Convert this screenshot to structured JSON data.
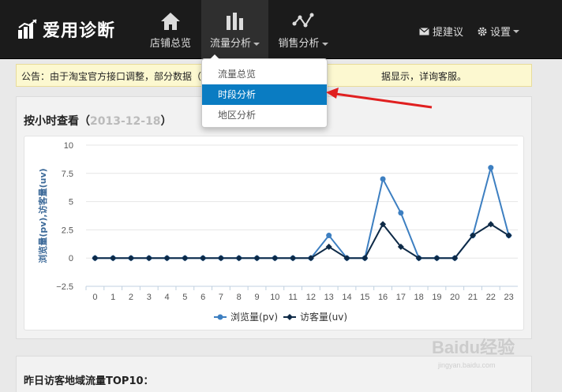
{
  "brand": {
    "name": "爱用诊断"
  },
  "nav": {
    "items": [
      {
        "label": "店铺总览",
        "icon": "home-icon"
      },
      {
        "label": "流量分析",
        "icon": "bar-chart-icon"
      },
      {
        "label": "销售分析",
        "icon": "line-chart-icon"
      }
    ],
    "suggest": "提建议",
    "settings": "设置"
  },
  "notice": {
    "prefix": "公告：由于淘宝官方接口调整，部分数据（",
    "suffix": "据显示，详询客服。"
  },
  "dropdown": {
    "items": [
      "流量总览",
      "时段分析",
      "地区分析"
    ],
    "active_index": 1
  },
  "panel": {
    "title": "按小时查看（",
    "date": "2013-12-18",
    "title_end": "）"
  },
  "chart_data": {
    "type": "line",
    "x": [
      0,
      1,
      2,
      3,
      4,
      5,
      6,
      7,
      8,
      9,
      10,
      11,
      12,
      13,
      14,
      15,
      16,
      17,
      18,
      19,
      20,
      21,
      22,
      23
    ],
    "ylim": [
      -2.5,
      10
    ],
    "yticks": [
      "10",
      "7.5",
      "5",
      "2.5",
      "0",
      "−2.5"
    ],
    "ylabel": "浏览量(pv),访客量(uv)",
    "legend_position": "bottom",
    "grid": true,
    "series": [
      {
        "name": "浏览量(pv)",
        "color": "#3d7fc1",
        "values": [
          0,
          0,
          0,
          0,
          0,
          0,
          0,
          0,
          0,
          0,
          0,
          0,
          0,
          2,
          0,
          0,
          7,
          4,
          0,
          0,
          0,
          2,
          8,
          2
        ]
      },
      {
        "name": "访客量(uv)",
        "color": "#0e2a47",
        "values": [
          0,
          0,
          0,
          0,
          0,
          0,
          0,
          0,
          0,
          0,
          0,
          0,
          0,
          1,
          0,
          0,
          3,
          1,
          0,
          0,
          0,
          2,
          3,
          2
        ]
      }
    ]
  },
  "panel2": {
    "title": "昨日访客地域流量TOP10："
  },
  "watermark": {
    "text": "Baidu经验",
    "sub": "jingyan.baidu.com"
  }
}
